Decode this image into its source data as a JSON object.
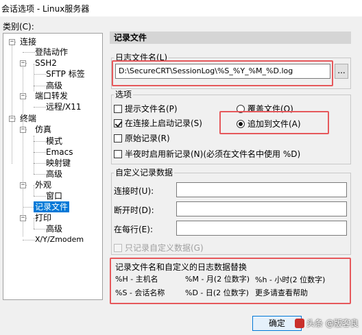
{
  "window": {
    "title": "会话选项 - Linux服务器"
  },
  "category_label": "类别(C):",
  "tree": {
    "connection": "连接",
    "login_actions": "登陆动作",
    "ssh2": "SSH2",
    "sftp_tab": "SFTP 标签",
    "ssh2_advanced": "高级",
    "port_forwarding": "端口转发",
    "remote_x11": "远程/X11",
    "terminal": "终端",
    "emulation": "仿真",
    "modes": "模式",
    "emacs": "Emacs",
    "mapped_keys": "映射键",
    "emulation_advanced": "高级",
    "appearance": "外观",
    "window": "窗口",
    "log_file": "记录文件",
    "printing": "打印",
    "printing_advanced": "高级",
    "xyzmodem": "X/Y/Zmodem"
  },
  "section_title": "记录文件",
  "log_filename": {
    "label": "日志文件名(L)",
    "value": "D:\\SecureCRT\\SessionLog\\%S_%Y_%M_%D.log",
    "browse_label": "..."
  },
  "options": {
    "title": "选项",
    "prompt_filename": {
      "label": "提示文件名(P)",
      "checked": false
    },
    "start_on_connect": {
      "label": "在连接上启动记录(S)",
      "checked": true
    },
    "raw_log": {
      "label": "原始记录(R)",
      "checked": false
    },
    "midnight_new_log": {
      "label": "半夜时启用新记录(N)(必须在文件名中使用 %D)",
      "checked": false
    },
    "overwrite_file": {
      "label": "覆盖文件(O)",
      "selected": false
    },
    "append_file": {
      "label": "追加到文件(A)",
      "selected": true
    }
  },
  "custom_log": {
    "title": "自定义记录数据",
    "on_connect": "连接时(U):",
    "on_disconnect": "断开时(D):",
    "on_each_line": "在每行(E):",
    "only_custom": "只记录自定义数据(G)"
  },
  "substitutions": {
    "title": "记录文件名和自定义的日志数据替换",
    "host": "%H - 主机名",
    "month": "%M - 月(2 位数字)",
    "hour": "%h - 小时(2 位数字)",
    "session": "%S - 会话名称",
    "day": "%D - 日(2 位数字)",
    "more_help": "更多请查看帮助"
  },
  "ok_label": "确定",
  "watermark": "头条 @版客良"
}
